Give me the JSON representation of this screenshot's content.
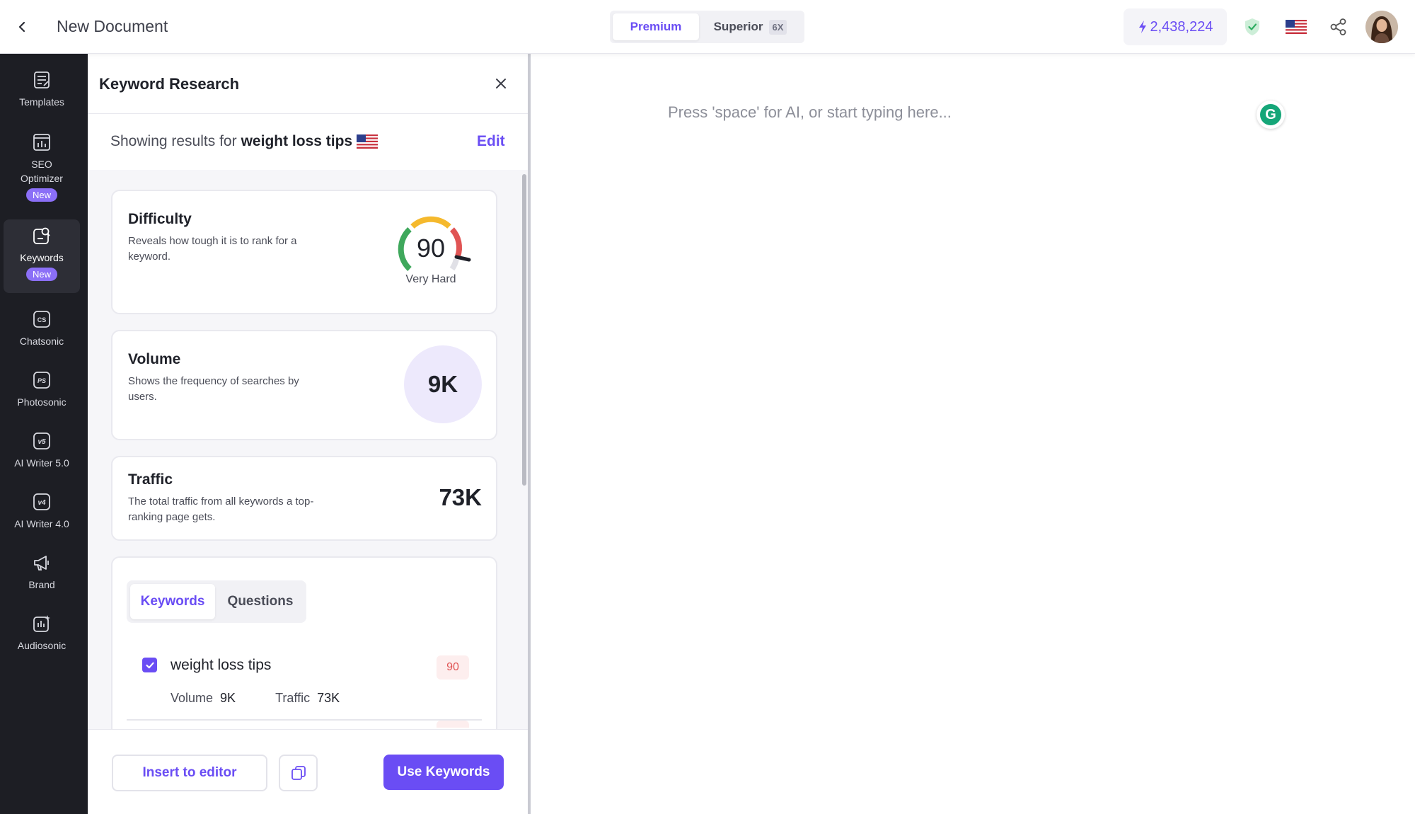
{
  "topbar": {
    "doc_title": "New Document",
    "modes": [
      {
        "label": "Premium",
        "active": true
      },
      {
        "label": "Superior",
        "badge": "6X",
        "active": false
      }
    ],
    "credits": "2,438,224",
    "icons": [
      "back-arrow-icon",
      "lightning-icon",
      "shield-check-icon",
      "us-flag-icon",
      "share-icon"
    ]
  },
  "sidebar": {
    "items": [
      {
        "label": "Templates",
        "icon": "templates-icon"
      },
      {
        "label": "SEO\nOptimizer",
        "badge": "New",
        "icon": "seo-chart-icon"
      },
      {
        "label": "Keywords",
        "badge": "New",
        "icon": "keywords-icon",
        "active": true
      },
      {
        "label": "Chatsonic",
        "icon": "chatsonic-icon"
      },
      {
        "label": "Photosonic",
        "icon": "photosonic-icon"
      },
      {
        "label": "AI Writer 5.0",
        "icon": "ai-writer-5-icon"
      },
      {
        "label": "AI Writer 4.0",
        "icon": "ai-writer-4-icon"
      },
      {
        "label": "Brand",
        "icon": "megaphone-icon"
      },
      {
        "label": "Audiosonic",
        "icon": "audiosonic-icon"
      }
    ]
  },
  "panel": {
    "title": "Keyword Research",
    "results_prefix": "Showing results for",
    "results_keyword": "weight loss tips",
    "edit_label": "Edit",
    "difficulty": {
      "title": "Difficulty",
      "desc": "Reveals how tough it is to rank for a keyword.",
      "value": "90",
      "label": "Very Hard",
      "score_fraction": 0.9
    },
    "volume": {
      "title": "Volume",
      "desc": "Shows the frequency of searches by users.",
      "value": "9K"
    },
    "traffic": {
      "title": "Traffic",
      "desc": "The total traffic from all keywords a top-ranking page gets.",
      "value": "73K"
    },
    "tabs": [
      {
        "label": "Keywords",
        "active": true
      },
      {
        "label": "Questions",
        "active": false
      }
    ],
    "keywords": [
      {
        "text": "weight loss tips",
        "score": "90",
        "checked": true,
        "volume_label": "Volume",
        "volume": "9K",
        "traffic_label": "Traffic",
        "traffic": "73K"
      }
    ],
    "footer": {
      "insert_label": "Insert to editor",
      "use_label": "Use Keywords"
    }
  },
  "editor": {
    "placeholder": "Press 'space' for AI, or start typing here...",
    "grammarly_letter": "G"
  },
  "colors": {
    "accent": "#6a4df4",
    "sidebar_bg": "#1d1e24",
    "hard_red": "#e05454",
    "badge_purple": "#8b6ff7"
  }
}
